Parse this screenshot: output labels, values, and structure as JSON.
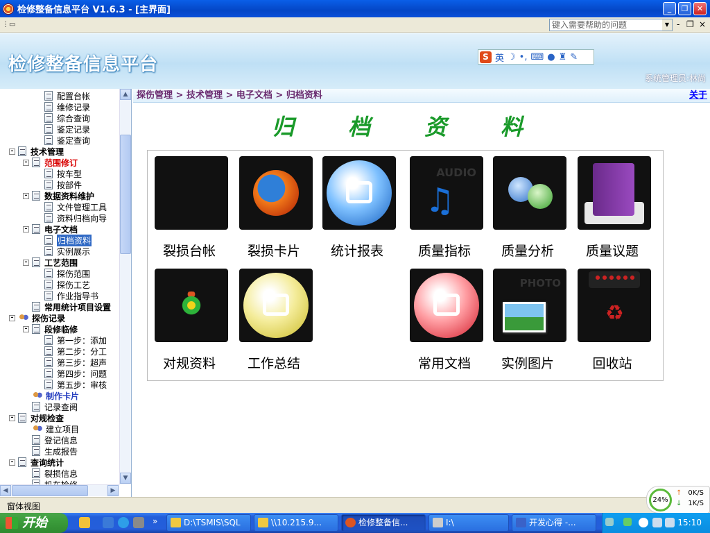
{
  "window": {
    "title": "检修整备信息平台 V1.6.3 - [主界面]"
  },
  "menubar": {
    "help_placeholder": "键入需要帮助的问题"
  },
  "banner": {
    "title": "检修整备信息平台",
    "ime_chars": "英",
    "admin": "系统管理员:林尚"
  },
  "tree": [
    {
      "label": "配置台帐",
      "level": 3,
      "icon": "doc"
    },
    {
      "label": "维修记录",
      "level": 3,
      "icon": "doc"
    },
    {
      "label": "综合查询",
      "level": 3,
      "icon": "doc"
    },
    {
      "label": "鉴定记录",
      "level": 3,
      "icon": "doc"
    },
    {
      "label": "鉴定查询",
      "level": 3,
      "icon": "doc"
    },
    {
      "label": "技术管理",
      "level": 1,
      "icon": "doc",
      "expand": "-",
      "style": "bold"
    },
    {
      "label": "范围修订",
      "level": 2,
      "icon": "doc",
      "expand": "-",
      "style": "bold red"
    },
    {
      "label": "按车型",
      "level": 3,
      "icon": "doc"
    },
    {
      "label": "按部件",
      "level": 3,
      "icon": "doc"
    },
    {
      "label": "数据资料维护",
      "level": 2,
      "icon": "doc",
      "expand": "-",
      "style": "bold"
    },
    {
      "label": "文件管理工具",
      "level": 3,
      "icon": "doc"
    },
    {
      "label": "资料归档向导",
      "level": 3,
      "icon": "doc"
    },
    {
      "label": "电子文档",
      "level": 2,
      "icon": "doc",
      "expand": "-",
      "style": "bold"
    },
    {
      "label": "归档资料",
      "level": 3,
      "icon": "doc",
      "style": "sel"
    },
    {
      "label": "实例展示",
      "level": 3,
      "icon": "doc"
    },
    {
      "label": "工艺范围",
      "level": 2,
      "icon": "doc",
      "expand": "-",
      "style": "bold"
    },
    {
      "label": "探伤范围",
      "level": 3,
      "icon": "doc"
    },
    {
      "label": "探伤工艺",
      "level": 3,
      "icon": "doc"
    },
    {
      "label": "作业指导书",
      "level": 3,
      "icon": "doc"
    },
    {
      "label": "常用统计项目设置",
      "level": 2,
      "icon": "doc",
      "style": "bold"
    },
    {
      "label": "探伤记录",
      "level": 1,
      "icon": "ppl",
      "expand": "-",
      "style": "bold"
    },
    {
      "label": "段修临修",
      "level": 2,
      "icon": "doc",
      "expand": "-",
      "style": "bold"
    },
    {
      "label": "第一步：添加",
      "level": 3,
      "icon": "doc"
    },
    {
      "label": "第二步：分工",
      "level": 3,
      "icon": "doc"
    },
    {
      "label": "第三步：超声",
      "level": 3,
      "icon": "doc"
    },
    {
      "label": "第四步：问题",
      "level": 3,
      "icon": "doc"
    },
    {
      "label": "第五步：审核",
      "level": 3,
      "icon": "doc"
    },
    {
      "label": "制作卡片",
      "level": 2,
      "icon": "ppl",
      "style": "bold blue"
    },
    {
      "label": "记录查阅",
      "level": 2,
      "icon": "doc"
    },
    {
      "label": "对规检查",
      "level": 1,
      "icon": "doc",
      "expand": "-",
      "style": "bold"
    },
    {
      "label": "建立项目",
      "level": 2,
      "icon": "ppl"
    },
    {
      "label": "登记信息",
      "level": 2,
      "icon": "doc"
    },
    {
      "label": "生成报告",
      "level": 2,
      "icon": "doc"
    },
    {
      "label": "查询统计",
      "level": 1,
      "icon": "doc",
      "expand": "-",
      "style": "bold"
    },
    {
      "label": "裂损信息",
      "level": 2,
      "icon": "doc"
    },
    {
      "label": "机车检修",
      "level": 2,
      "icon": "doc"
    }
  ],
  "content": {
    "breadcrumb": "探伤管理 > 技术管理 > 电子文档 > 归档资料",
    "close_label": "关于",
    "heading": "归档资料",
    "tiles": [
      {
        "label": "裂损台帐",
        "icon": "mailbox-icon",
        "col": 0,
        "row": 0
      },
      {
        "label": "裂损卡片",
        "icon": "firefox-icon",
        "col": 1,
        "row": 0
      },
      {
        "label": "统计报表",
        "icon": "blue-orb-icon",
        "col": 2,
        "row": 0
      },
      {
        "label": "质量指标",
        "icon": "audio-icon",
        "col": 3,
        "row": 0
      },
      {
        "label": "质量分析",
        "icon": "people-icon",
        "col": 4,
        "row": 0
      },
      {
        "label": "质量议题",
        "icon": "book-icon",
        "col": 5,
        "row": 0
      },
      {
        "label": "对规资料",
        "icon": "flower-icon",
        "col": 0,
        "row": 1
      },
      {
        "label": "工作总结",
        "icon": "yellow-orb-icon",
        "col": 1,
        "row": 1
      },
      {
        "label": "常用文档",
        "icon": "red-orb-icon",
        "col": 3,
        "row": 1
      },
      {
        "label": "实例图片",
        "icon": "photo-icon",
        "col": 4,
        "row": 1
      },
      {
        "label": "回收站",
        "icon": "recycle-bin-icon",
        "col": 5,
        "row": 1
      }
    ]
  },
  "statusbar": {
    "text": "窗体视图",
    "cpu": "24%",
    "up": "0K/S",
    "down": "1K/S"
  },
  "taskbar": {
    "start": "开始",
    "tasks": [
      {
        "label": "D:\\TSMIS\\SQL"
      },
      {
        "label": "\\\\10.215.9..."
      },
      {
        "label": "检修整备信..."
      },
      {
        "label": "I:\\"
      },
      {
        "label": "开发心得 -..."
      }
    ],
    "clock": "15:10"
  }
}
